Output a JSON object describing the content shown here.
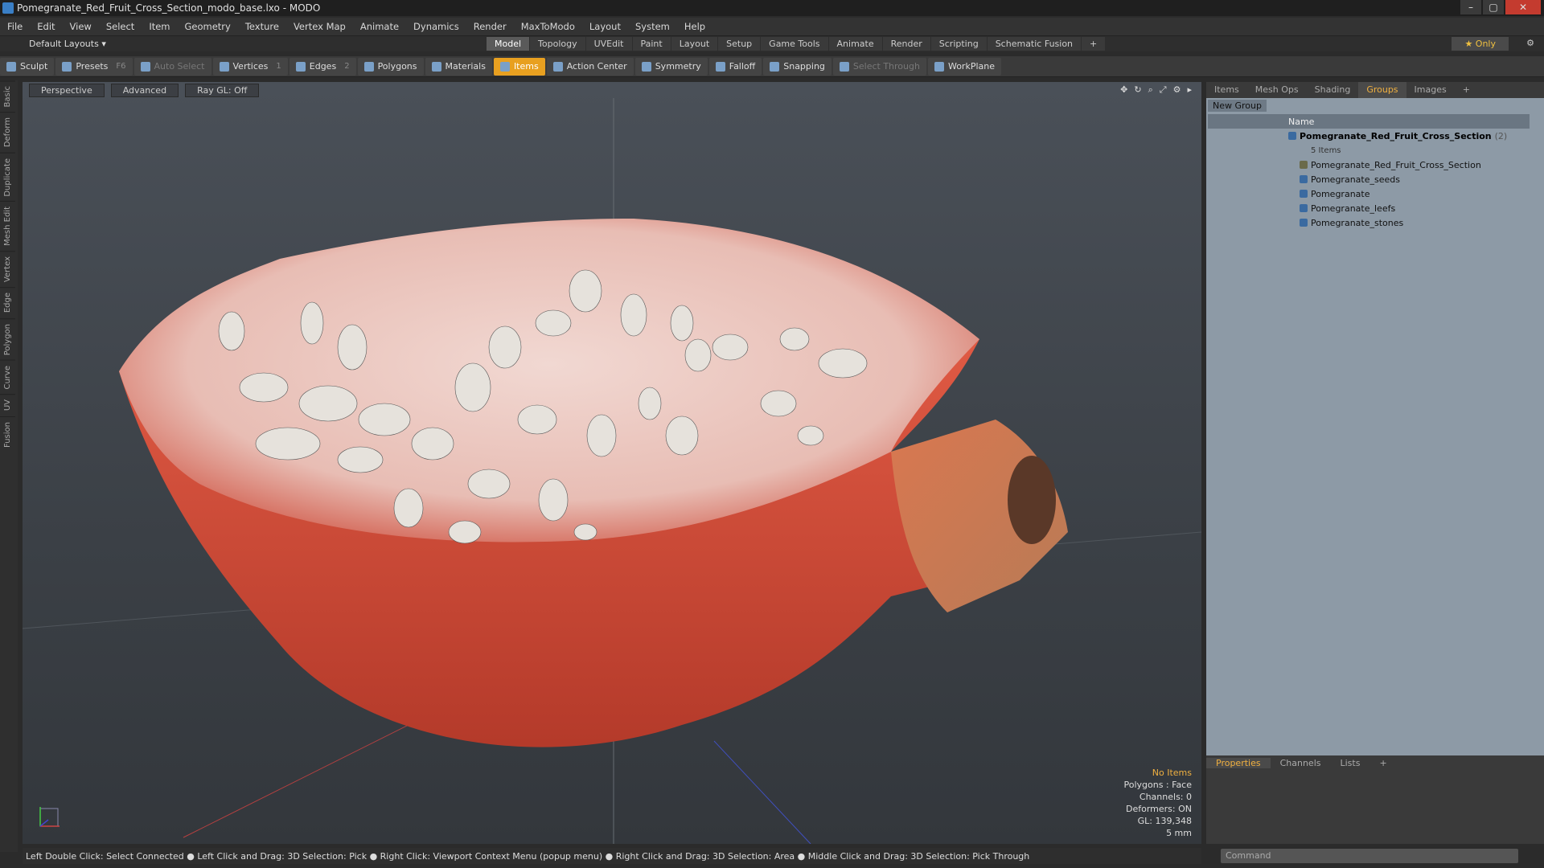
{
  "window": {
    "title": "Pomegranate_Red_Fruit_Cross_Section_modo_base.lxo - MODO"
  },
  "menu": [
    "File",
    "Edit",
    "View",
    "Select",
    "Item",
    "Geometry",
    "Texture",
    "Vertex Map",
    "Animate",
    "Dynamics",
    "Render",
    "MaxToModo",
    "Layout",
    "System",
    "Help"
  ],
  "layout": {
    "dropdown": "Default Layouts",
    "tabs": [
      "Model",
      "Topology",
      "UVEdit",
      "Paint",
      "Layout",
      "Setup",
      "Game Tools",
      "Animate",
      "Render",
      "Scripting",
      "Schematic Fusion"
    ],
    "active_tab": "Model",
    "only": "Only"
  },
  "toolbar": {
    "sculpt": "Sculpt",
    "presets": "Presets",
    "presets_key": "F6",
    "auto_select": "Auto Select",
    "vertices": "Vertices",
    "vertices_count": "1",
    "edges": "Edges",
    "edges_count": "2",
    "polygons": "Polygons",
    "materials": "Materials",
    "items": "Items",
    "action_center": "Action Center",
    "symmetry": "Symmetry",
    "falloff": "Falloff",
    "snapping": "Snapping",
    "select_through": "Select Through",
    "workplane": "WorkPlane"
  },
  "left_tabs": [
    "Basic",
    "Deform",
    "Duplicate",
    "Mesh Edit",
    "Vertex",
    "Edge",
    "Polygon",
    "Curve",
    "UV",
    "Fusion"
  ],
  "viewport": {
    "view": "Perspective",
    "mode": "Advanced",
    "raygl": "Ray GL: Off",
    "info": {
      "items": "No Items",
      "polygons": "Polygons : Face",
      "channels": "Channels: 0",
      "deformers": "Deformers: ON",
      "gl": "GL: 139,348",
      "scale": "5 mm"
    }
  },
  "status": "Left Double Click: Select Connected ● Left Click and Drag: 3D Selection: Pick ● Right Click: Viewport Context Menu (popup menu) ● Right Click and Drag: 3D Selection: Area ● Middle Click and Drag: 3D Selection: Pick Through",
  "right_panel": {
    "tabs": [
      "Items",
      "Mesh Ops",
      "Shading",
      "Groups",
      "Images"
    ],
    "active_tab": "Groups",
    "new_group": "New Group",
    "column": "Name",
    "root": {
      "label": "Pomegranate_Red_Fruit_Cross_Section",
      "count": "(2)",
      "sub": "5 Items"
    },
    "children": [
      "Pomegranate_Red_Fruit_Cross_Section",
      "Pomegranate_seeds",
      "Pomegranate",
      "Pomegranate_leefs",
      "Pomegranate_stones"
    ]
  },
  "properties_panel": {
    "tabs": [
      "Properties",
      "Channels",
      "Lists"
    ],
    "active_tab": "Properties"
  },
  "command": {
    "placeholder": "Command"
  },
  "colors": {
    "accent": "#f0b040",
    "active_tool": "#e8a020",
    "groups_bg": "#8d9aa6",
    "fruit_red": "#d84a36"
  }
}
